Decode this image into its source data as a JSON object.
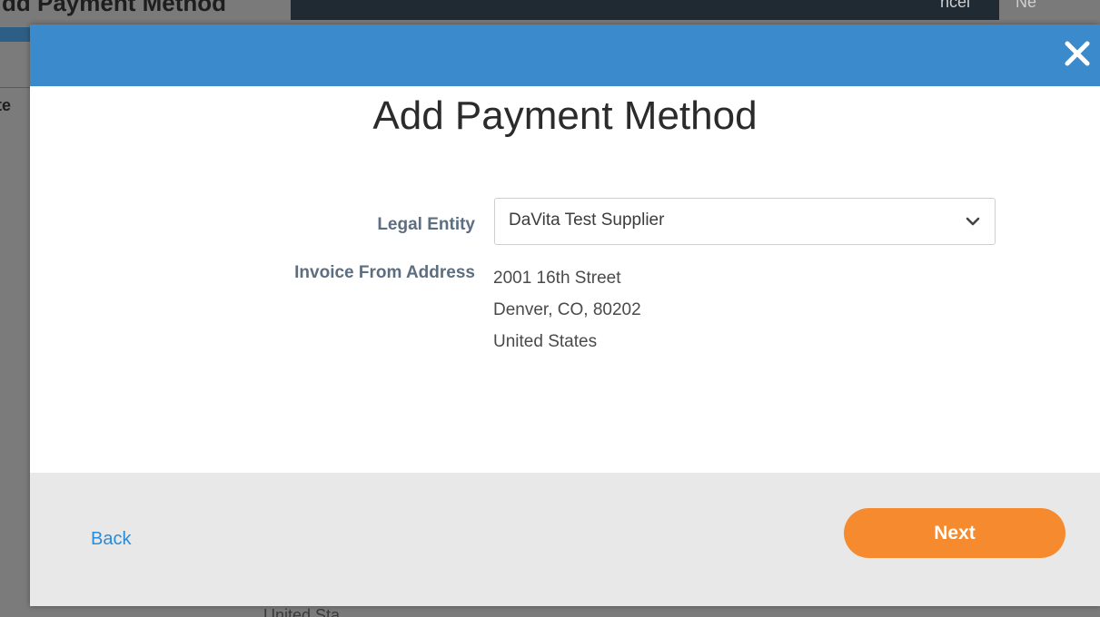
{
  "background": {
    "title": "dd Payment Method",
    "right_text_1": "ncel",
    "right_text_2": "Ne",
    "left_fragment": "te",
    "bottom_fragment": "United Sta"
  },
  "modal": {
    "title": "Add Payment Method",
    "close_icon": "close-icon",
    "form": {
      "legal_entity_label": "Legal Entity",
      "legal_entity_value": "DaVita Test Supplier",
      "invoice_address_label": "Invoice From Address",
      "address_lines": [
        "2001 16th Street",
        "Denver, CO, 80202",
        "United States"
      ]
    },
    "footer": {
      "back_label": "Back",
      "next_label": "Next"
    }
  },
  "colors": {
    "header_blue": "#3b8bcc",
    "next_orange": "#f68a2e",
    "link_blue": "#2a8bd8",
    "label_slate": "#5c6e80",
    "footer_gray": "#e8e8e8"
  }
}
